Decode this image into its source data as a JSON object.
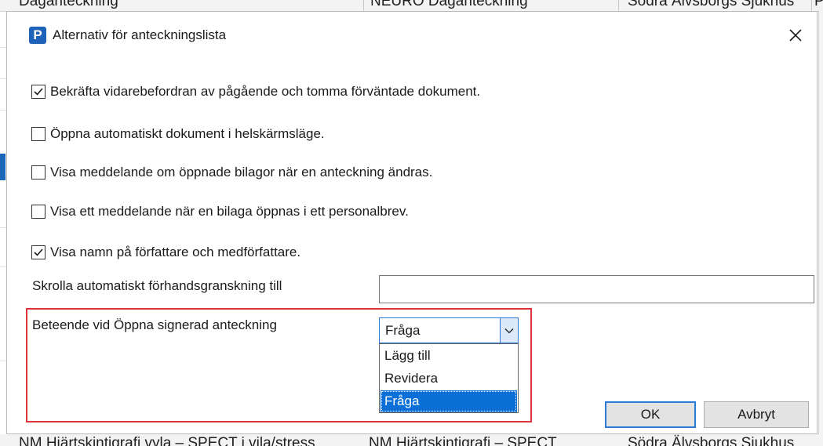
{
  "background": {
    "top_cells": [
      "Daganteckning",
      "NEURO Daganteckning",
      "Södra Älvsborgs Sjukhus",
      "P"
    ],
    "bottom_cells": [
      "NM Hjärtskintigrafi vyla – SPECT i vila/stress",
      "NM Hjärtskintigrafi – SPECT",
      "Södra Älvsborgs Sjukhus"
    ]
  },
  "dialog": {
    "icon_letter": "P",
    "title": "Alternativ för anteckningslista",
    "close_symbol": "✕"
  },
  "options": [
    {
      "label": "Bekräfta vidarebefordran av pågående och tomma förväntade dokument.",
      "checked": true
    },
    {
      "label": "Öppna automatiskt dokument i helskärmsläge.",
      "checked": false
    },
    {
      "label": "Visa meddelande om öppnade bilagor när en anteckning ändras.",
      "checked": false
    },
    {
      "label": "Visa ett meddelande när en bilaga öppnas i ett personalbrev.",
      "checked": false
    },
    {
      "label": "Visa namn på författare och medförfattare.",
      "checked": true
    }
  ],
  "scroll_preview": {
    "label": "Skrolla automatiskt förhandsgranskning till",
    "value": ""
  },
  "open_signed": {
    "label": "Beteende vid Öppna signerad anteckning",
    "selected": "Fråga",
    "options": [
      "Lägg till",
      "Revidera",
      "Fråga"
    ]
  },
  "buttons": {
    "ok": "OK",
    "cancel": "Avbryt"
  },
  "colors": {
    "accent": "#0a6fd6",
    "highlight_border": "#e0343b",
    "icon_bg": "#1e63b8"
  }
}
